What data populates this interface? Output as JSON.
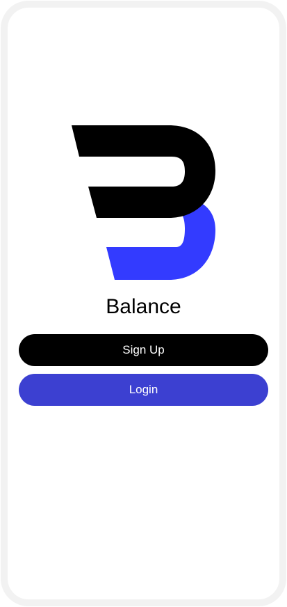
{
  "app": {
    "title": "Balance"
  },
  "actions": {
    "signup_label": "Sign Up",
    "login_label": "Login"
  },
  "colors": {
    "logo_top": "#000000",
    "logo_bottom": "#333bff",
    "signup_button": "#000000",
    "login_button": "#3c40d1",
    "frame": "#f2f2f2"
  },
  "icons": {
    "logo": "balance-b-logo-icon"
  }
}
